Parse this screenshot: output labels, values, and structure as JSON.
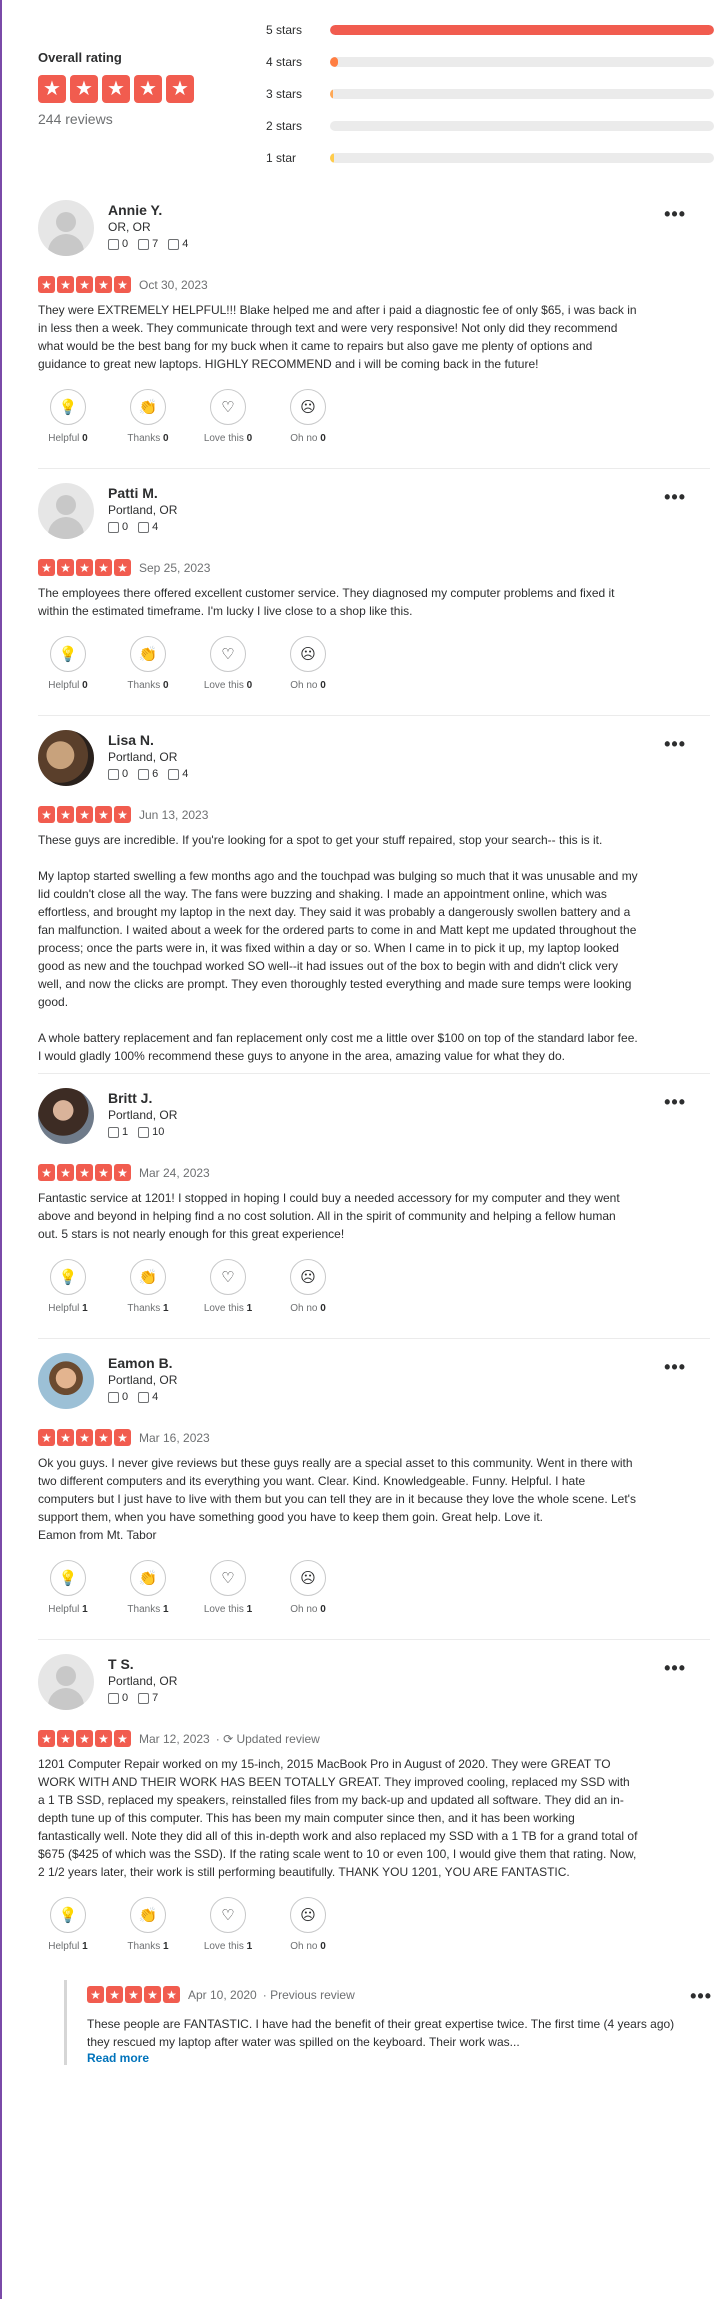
{
  "overall": {
    "title": "Overall rating",
    "reviews_count": "244 reviews",
    "stars": 5
  },
  "distribution": [
    {
      "label": "5 stars",
      "fraction": 1.0,
      "color": "#f15c4f"
    },
    {
      "label": "4 stars",
      "fraction": 0.02,
      "color": "#ff7e42"
    },
    {
      "label": "3 stars",
      "fraction": 0.004,
      "color": "#ffa855"
    },
    {
      "label": "2 stars",
      "fraction": 0.0,
      "color": "#ffcc4b"
    },
    {
      "label": "1 star",
      "fraction": 0.01,
      "color": "#ffcc4b"
    }
  ],
  "reactions": {
    "helpful": "Helpful",
    "thanks": "Thanks",
    "love": "Love this",
    "ohno": "Oh no"
  },
  "reviews": [
    {
      "name": "Annie Y.",
      "location": "OR, OR",
      "friends": "0",
      "reviews": "7",
      "photos": "4",
      "rating": 5,
      "date": "Oct 30, 2023",
      "text": "They were EXTREMELY HELPFUL!!! Blake helped me and after i paid a diagnostic fee of only $65, i was back in in less then a week. They communicate through text and were very responsive! Not only did they recommend what would be the best bang for my buck when it came to repairs but also gave me plenty of options and guidance to great new laptops. HIGHLY RECOMMEND and i will be coming back in the future!",
      "helpful": "0",
      "thanks": "0",
      "love": "0",
      "ohno": "0"
    },
    {
      "name": "Patti M.",
      "location": "Portland, OR",
      "friends": "0",
      "reviews": "4",
      "rating": 5,
      "date": "Sep 25, 2023",
      "text": "The employees there offered excellent customer service. They diagnosed my computer problems and fixed it within the estimated timeframe. I'm lucky I live close to a shop like this.",
      "helpful": "0",
      "thanks": "0",
      "love": "0",
      "ohno": "0"
    },
    {
      "name": "Lisa N.",
      "location": "Portland, OR",
      "friends": "0",
      "reviews": "6",
      "photos": "4",
      "rating": 5,
      "date": "Jun 13, 2023",
      "text": "These guys are incredible. If you're looking for a spot to get your stuff repaired, stop your search-- this is it.\n\nMy laptop started swelling a few months ago and the touchpad was bulging so much that it was unusable and my lid couldn't close all the way. The fans were buzzing and shaking. I made an appointment online, which was effortless, and brought my laptop in the next day. They said it was probably a dangerously swollen battery and a fan malfunction. I waited about a week for the ordered parts to come in and Matt kept me updated throughout the process; once the parts were in, it was fixed within a day or so. When I came in to pick it up, my laptop looked good as new and the touchpad worked SO well--it had issues out of the box to begin with and didn't click very well, and now the clicks are prompt. They even thoroughly tested everything and made sure temps were looking good.\n\nA whole battery replacement and fan replacement only cost me a little over $100 on top of the standard labor fee. I would gladly 100% recommend these guys to anyone in the area, amazing value for what they do."
    },
    {
      "name": "Britt J.",
      "location": "Portland, OR",
      "friends": "1",
      "reviews": "10",
      "rating": 5,
      "date": "Mar 24, 2023",
      "text": "Fantastic service at 1201! I stopped in hoping I could buy a needed accessory for my computer and they went above and beyond in helping find a no cost solution. All in the spirit of community and helping a fellow human out. 5 stars is not nearly enough for this great experience!",
      "helpful": "1",
      "thanks": "1",
      "love": "1",
      "ohno": "0"
    },
    {
      "name": "Eamon B.",
      "location": "Portland, OR",
      "friends": "0",
      "reviews": "4",
      "rating": 5,
      "date": "Mar 16, 2023",
      "text": "Ok you guys. I never give reviews but these guys really are a special asset to this community. Went in there with two different computers and its everything you want. Clear. Kind. Knowledgeable. Funny. Helpful. I hate computers but I just have to live with them but you can tell they are in it because they love the whole scene. Let's support them, when you have something good you have to keep them goin. Great help. Love it.\nEamon from Mt. Tabor",
      "helpful": "1",
      "thanks": "1",
      "love": "1",
      "ohno": "0"
    },
    {
      "name": "T S.",
      "location": "Portland, OR",
      "friends": "0",
      "reviews": "7",
      "rating": 5,
      "date": "Mar 12, 2023",
      "updated": "Updated review",
      "text": "1201 Computer Repair worked on my 15-inch, 2015 MacBook Pro in August of 2020. They were GREAT TO WORK WITH AND THEIR WORK HAS BEEN TOTALLY GREAT. They improved cooling, replaced my SSD with a 1 TB SSD, replaced my speakers, reinstalled files from my back-up and updated all software. They did an in-depth tune up of this computer. This has been my main computer since then, and it has been working fantastically well. Note they did all of this in-depth work and also replaced my SSD with a 1 TB for a grand total of $675 ($425 of which was the SSD). If the rating scale went to 10 or even 100, I would give them that rating. Now, 2 1/2 years later, their work is still performing beautifully. THANK YOU 1201, YOU ARE FANTASTIC.",
      "helpful": "1",
      "thanks": "1",
      "love": "1",
      "ohno": "0",
      "previous": {
        "date": "Apr 10, 2020",
        "label": "Previous review",
        "text": "These people are FANTASTIC. I have had the benefit of their great expertise twice. The first time (4 years ago) they rescued my laptop after water was spilled on the keyboard. Their work was...",
        "read_more": "Read more"
      }
    }
  ],
  "icons": {
    "star": "★",
    "more": "•••",
    "helpful": "lightbulb-icon",
    "thanks": "clapping-hands-icon",
    "love": "heart-icon",
    "ohno": "sad-face-icon"
  }
}
